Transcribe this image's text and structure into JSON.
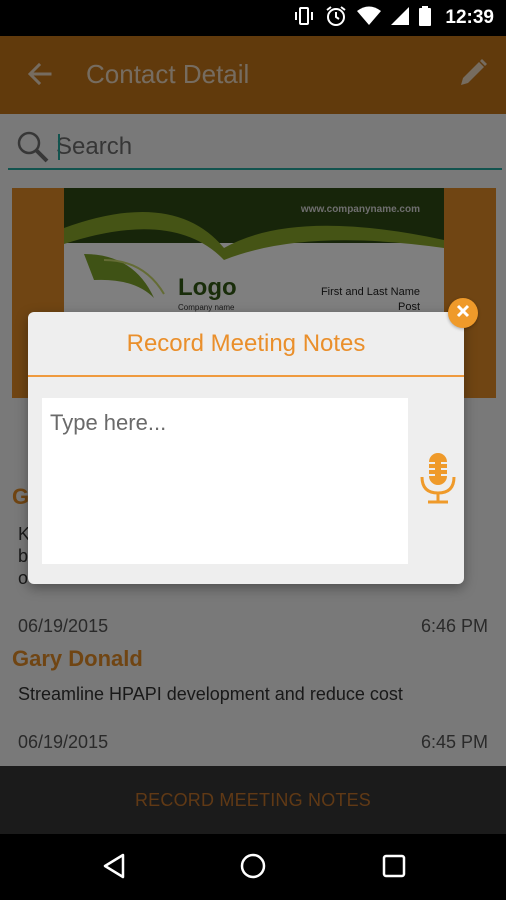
{
  "status_bar": {
    "time": "12:39",
    "icons": [
      "vibrate-icon",
      "alarm-icon",
      "wifi-icon",
      "signal-icon",
      "battery-icon"
    ]
  },
  "app_bar": {
    "title": "Contact Detail",
    "back_icon": "arrow-back-icon",
    "edit_icon": "pencil-icon"
  },
  "search": {
    "placeholder": "Search",
    "value": ""
  },
  "business_card": {
    "url": "www.companyname.com",
    "logo": "Logo",
    "company": "Company name",
    "name": "First and Last Name",
    "post": "Post"
  },
  "list": [
    {
      "name": "G",
      "note_lines": [
        "K",
        "b",
        "o"
      ],
      "date": "06/19/2015",
      "time": "6:46 PM"
    },
    {
      "name": "Gary Donald",
      "note": "Streamline HPAPI development and reduce cost",
      "date": "06/19/2015",
      "time": "6:45 PM"
    }
  ],
  "bottom_action": {
    "label": "RECORD MEETING NOTES"
  },
  "dialog": {
    "title": "Record Meeting Notes",
    "placeholder": "Type here...",
    "value": "",
    "mic_icon": "microphone-icon",
    "close_icon": "close-icon"
  },
  "nav_bar": {
    "icons": [
      "nav-back-icon",
      "nav-home-icon",
      "nav-recents-icon"
    ]
  },
  "colors": {
    "app_bar": "#c27418",
    "accent": "#e18b26",
    "dialog_accent": "#ea8f2b",
    "search_underline": "#25a79c",
    "bottom_bar": "#363636"
  }
}
